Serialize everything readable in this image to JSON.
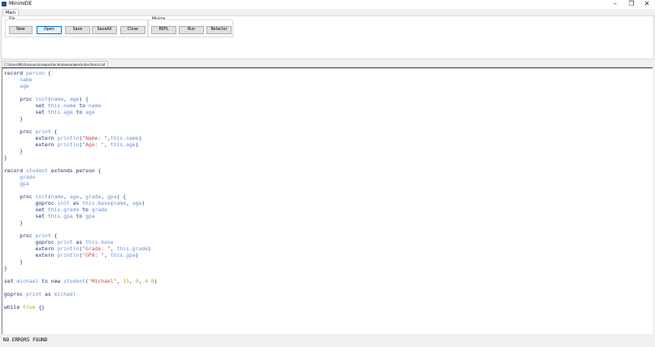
{
  "window": {
    "title": "MinimIDE"
  },
  "ribbon": {
    "tab": "Main",
    "groups": [
      {
        "label": "File",
        "buttons": [
          "New",
          "Open",
          "Save",
          "SaveAll",
          "Close"
        ]
      },
      {
        "label": "Minima",
        "buttons": [
          "REPL",
          "Run",
          "Refactor"
        ]
      }
    ]
  },
  "editor": {
    "file_path": "C:\\Users\\Micha\\source\\repos\\minima\\examples\\inheritance.txt",
    "code_lines": [
      [
        [
          "k",
          "record "
        ],
        [
          "i",
          "person"
        ],
        [
          "k",
          " {"
        ]
      ],
      [
        [
          "i",
          "     name"
        ]
      ],
      [
        [
          "i",
          "     age"
        ]
      ],
      [],
      [
        [
          "k",
          "     proc "
        ],
        [
          "i",
          "init"
        ],
        [
          "k",
          "("
        ],
        [
          "i",
          "name"
        ],
        [
          "k",
          ", "
        ],
        [
          "i",
          "age"
        ],
        [
          "k",
          ") {"
        ]
      ],
      [
        [
          "k",
          "          set "
        ],
        [
          "i",
          "this.name"
        ],
        [
          "k",
          " to "
        ],
        [
          "i",
          "name"
        ]
      ],
      [
        [
          "k",
          "          set "
        ],
        [
          "i",
          "this.age"
        ],
        [
          "k",
          " to "
        ],
        [
          "i",
          "age"
        ]
      ],
      [
        [
          "k",
          "     }"
        ]
      ],
      [],
      [
        [
          "k",
          "     proc "
        ],
        [
          "i",
          "print"
        ],
        [
          "k",
          " {"
        ]
      ],
      [
        [
          "k",
          "          extern "
        ],
        [
          "i",
          "println"
        ],
        [
          "k",
          "("
        ],
        [
          "s",
          "\"Name: \""
        ],
        [
          "k",
          ","
        ],
        [
          "i",
          "this.name"
        ],
        [
          "k",
          ")"
        ]
      ],
      [
        [
          "k",
          "          extern "
        ],
        [
          "i",
          "println"
        ],
        [
          "k",
          "("
        ],
        [
          "s",
          "\"Age: \""
        ],
        [
          "k",
          ", "
        ],
        [
          "i",
          "this.age"
        ],
        [
          "k",
          ")"
        ]
      ],
      [
        [
          "k",
          "     }"
        ]
      ],
      [
        [
          "k",
          "}"
        ]
      ],
      [],
      [
        [
          "k",
          "record "
        ],
        [
          "i",
          "student"
        ],
        [
          "k",
          " extends "
        ],
        [
          "k",
          "person {"
        ]
      ],
      [
        [
          "i",
          "     grade"
        ]
      ],
      [
        [
          "i",
          "     gpa"
        ]
      ],
      [],
      [
        [
          "k",
          "     proc "
        ],
        [
          "i",
          "init"
        ],
        [
          "k",
          "("
        ],
        [
          "i",
          "name"
        ],
        [
          "k",
          ", "
        ],
        [
          "i",
          "age"
        ],
        [
          "k",
          ", "
        ],
        [
          "i",
          "grade"
        ],
        [
          "k",
          ", "
        ],
        [
          "i",
          "gpa"
        ],
        [
          "k",
          ") {"
        ]
      ],
      [
        [
          "k",
          "          goproc "
        ],
        [
          "i",
          "init"
        ],
        [
          "k",
          " as "
        ],
        [
          "i",
          "this.base"
        ],
        [
          "k",
          "("
        ],
        [
          "i",
          "name"
        ],
        [
          "k",
          ", "
        ],
        [
          "i",
          "age"
        ],
        [
          "k",
          ")"
        ]
      ],
      [
        [
          "k",
          "          set "
        ],
        [
          "i",
          "this.grade"
        ],
        [
          "k",
          " to "
        ],
        [
          "i",
          "grade"
        ]
      ],
      [
        [
          "k",
          "          set "
        ],
        [
          "i",
          "this.gpa"
        ],
        [
          "k",
          " to "
        ],
        [
          "i",
          "gpa"
        ]
      ],
      [
        [
          "k",
          "     }"
        ]
      ],
      [],
      [
        [
          "k",
          "     proc "
        ],
        [
          "i",
          "print"
        ],
        [
          "k",
          " {"
        ]
      ],
      [
        [
          "k",
          "          goproc "
        ],
        [
          "i",
          "print"
        ],
        [
          "k",
          " as "
        ],
        [
          "i",
          "this.base"
        ]
      ],
      [
        [
          "k",
          "          extern "
        ],
        [
          "i",
          "println"
        ],
        [
          "k",
          "("
        ],
        [
          "s",
          "\"Grade: \""
        ],
        [
          "k",
          ", "
        ],
        [
          "i",
          "this.grade"
        ],
        [
          "k",
          ")"
        ]
      ],
      [
        [
          "k",
          "          extern "
        ],
        [
          "i",
          "println"
        ],
        [
          "k",
          "("
        ],
        [
          "s",
          "\"GPA: \""
        ],
        [
          "k",
          ", "
        ],
        [
          "i",
          "this.gpa"
        ],
        [
          "k",
          ")"
        ]
      ],
      [
        [
          "k",
          "     }"
        ]
      ],
      [
        [
          "k",
          "}"
        ]
      ],
      [],
      [
        [
          "k",
          "set "
        ],
        [
          "i",
          "michael"
        ],
        [
          "k",
          " to new "
        ],
        [
          "i",
          "student"
        ],
        [
          "k",
          "("
        ],
        [
          "s",
          "\"Michael\""
        ],
        [
          "k",
          ", "
        ],
        [
          "n",
          "15"
        ],
        [
          "k",
          ", "
        ],
        [
          "n",
          "9"
        ],
        [
          "k",
          ", "
        ],
        [
          "n",
          "4.0"
        ],
        [
          "k",
          ")"
        ]
      ],
      [],
      [
        [
          "k",
          "goproc "
        ],
        [
          "i",
          "print"
        ],
        [
          "k",
          " as "
        ],
        [
          "i",
          "michael"
        ]
      ],
      [],
      [
        [
          "k",
          "while "
        ],
        [
          "n",
          "true"
        ],
        [
          "k",
          " {}"
        ]
      ]
    ]
  },
  "status": {
    "text": "NO ERRORS FOUND"
  },
  "colors": {
    "keyword": "#1f2f7a",
    "identifier": "#6a8fd8",
    "string": "#c0504d",
    "number": "#c79b2c"
  }
}
